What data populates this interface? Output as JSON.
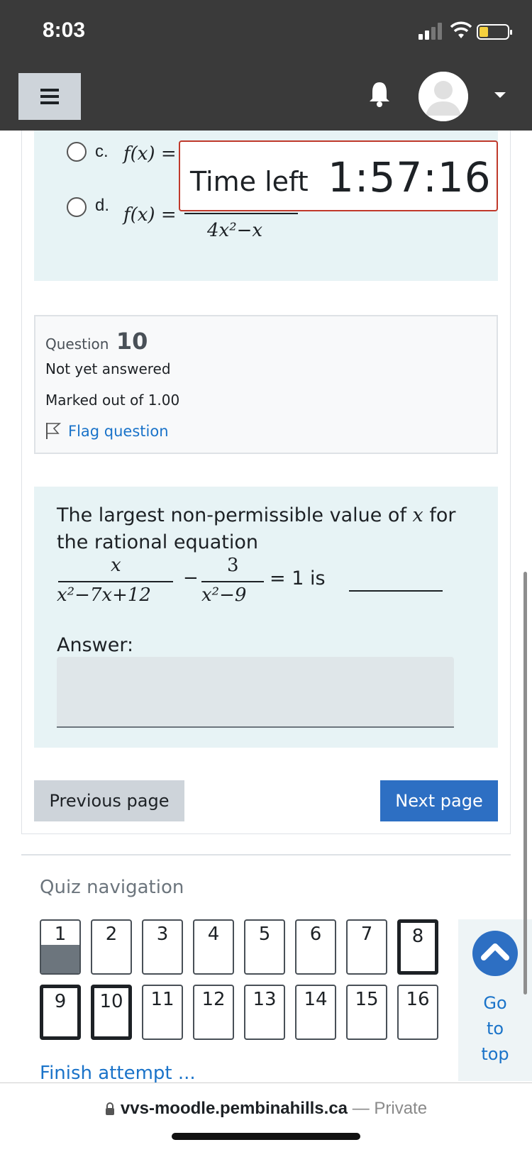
{
  "status_bar": {
    "time": "8:03"
  },
  "navbar": {
    "menu_icon": "hamburger-icon",
    "bell_icon": "bell-icon",
    "avatar_icon": "user-avatar-icon"
  },
  "timer": {
    "label": "Time left",
    "value": "1:57:16"
  },
  "previous_options": [
    {
      "letter": "c.",
      "lhs": "f(x) ="
    },
    {
      "letter": "d.",
      "lhs": "f(x) =",
      "denominator": "4x²−x"
    }
  ],
  "question_info": {
    "label": "Question",
    "number": "10",
    "status": "Not yet answered",
    "marked": "Marked out of 1.00",
    "flag_label": "Flag question"
  },
  "question": {
    "text_before": "The largest non-permissible value of ",
    "variable": "x",
    "text_after": " for the rational equation",
    "eq_num1": "x",
    "eq_den1": "x²−7x+12",
    "eq_minus": "−",
    "eq_num2": "3",
    "eq_den2": "x²−9",
    "eq_rhs": "= 1 is",
    "answer_label": "Answer:",
    "answer_value": ""
  },
  "buttons": {
    "previous": "Previous page",
    "next": "Next page"
  },
  "quiz_nav": {
    "title": "Quiz navigation",
    "questions": [
      "1",
      "2",
      "3",
      "4",
      "5",
      "6",
      "7",
      "8",
      "9",
      "10",
      "11",
      "12",
      "13",
      "14",
      "15",
      "16"
    ],
    "answered": [
      "1"
    ],
    "current": [
      "8",
      "9",
      "10"
    ],
    "finish_label": "Finish attempt ..."
  },
  "go_to_top": {
    "line1": "Go",
    "line2": "to",
    "line3": "top"
  },
  "browser": {
    "host": "vvs-moodle.pembinahills.ca",
    "separator": " — ",
    "privacy": "Private"
  },
  "colors": {
    "accent": "#2d6fc3",
    "link": "#1a73c9",
    "timer_border": "#c0392b",
    "question_bg": "#e7f3f5",
    "navbar": "#3a3a3a"
  }
}
